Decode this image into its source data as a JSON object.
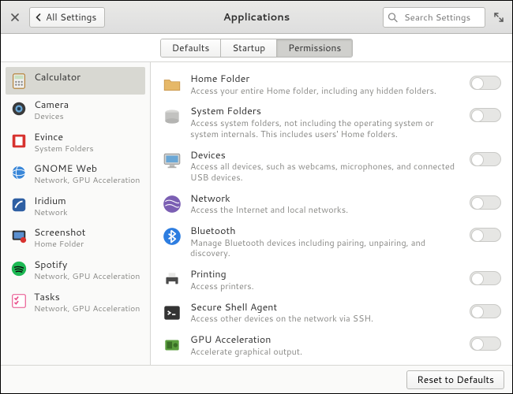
{
  "header": {
    "back_label": "All Settings",
    "title": "Applications",
    "search_placeholder": "Search Settings"
  },
  "tabs": {
    "items": [
      "Defaults",
      "Startup",
      "Permissions"
    ],
    "active_index": 2
  },
  "sidebar": {
    "selected_index": 0,
    "items": [
      {
        "name": "Calculator",
        "sub": "",
        "icon": "calculator",
        "bg": "#fafaf9"
      },
      {
        "name": "Camera",
        "sub": "Devices",
        "icon": "camera",
        "bg": "#3a3a3a"
      },
      {
        "name": "Evince",
        "sub": "System Folders",
        "icon": "evince",
        "bg": "#d7322f"
      },
      {
        "name": "GNOME Web",
        "sub": "Network, GPU Acceleration",
        "icon": "globe",
        "bg": "#3a87d8"
      },
      {
        "name": "Iridium",
        "sub": "Network",
        "icon": "iridium",
        "bg": "#2e5fa3"
      },
      {
        "name": "Screenshot",
        "sub": "Home Folder",
        "icon": "screenshot",
        "bg": "#2b2b2b"
      },
      {
        "name": "Spotify",
        "sub": "Network, GPU Acceleration",
        "icon": "spotify",
        "bg": "#1db954"
      },
      {
        "name": "Tasks",
        "sub": "Network, GPU Acceleration",
        "icon": "tasks",
        "bg": "#e84e8a"
      }
    ]
  },
  "permissions": [
    {
      "title": "Home Folder",
      "desc": "Access your entire Home folder, including any hidden folders.",
      "icon": "folder",
      "bg": "#e6b868",
      "on": false
    },
    {
      "title": "System Folders",
      "desc": "Access system folders, not including the operating system or system internals. This includes users' Home folders.",
      "icon": "drive",
      "bg": "#d0d0ce",
      "on": false
    },
    {
      "title": "Devices",
      "desc": "Access all devices, such as webcams, microphones, and connected USB devices.",
      "icon": "computer",
      "bg": "#c9c9c7",
      "on": false
    },
    {
      "title": "Network",
      "desc": "Access the Internet and local networks.",
      "icon": "network",
      "bg": "#7b5fb3",
      "on": false
    },
    {
      "title": "Bluetooth",
      "desc": "Manage Bluetooth devices including pairing, unpairing, and discovery.",
      "icon": "bluetooth",
      "bg": "#2d7de0",
      "on": false
    },
    {
      "title": "Printing",
      "desc": "Access printers.",
      "icon": "printer",
      "bg": "#4a4a4a",
      "on": false
    },
    {
      "title": "Secure Shell Agent",
      "desc": "Access other devices on the network via SSH.",
      "icon": "terminal",
      "bg": "#333333",
      "on": false
    },
    {
      "title": "GPU Acceleration",
      "desc": "Accelerate graphical output.",
      "icon": "gpu",
      "bg": "#5a9e3d",
      "on": false
    }
  ],
  "footer": {
    "reset_label": "Reset to Defaults"
  }
}
